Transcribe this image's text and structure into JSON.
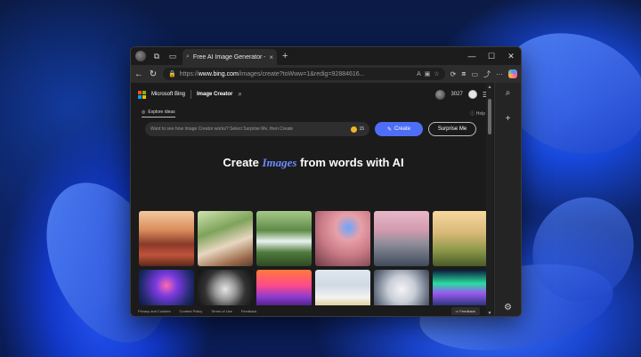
{
  "browser": {
    "tab_title": "Free AI Image Generator - Image",
    "url_prefix": "https://",
    "url_host": "www.bing.com",
    "url_path": "/images/create?toWww=1&redig=92884616..."
  },
  "bing": {
    "brand": "Microsoft Bing",
    "product": "Image Creator",
    "points": "3027"
  },
  "subnav": {
    "explore": "Explore ideas",
    "help": "Help"
  },
  "prompt": {
    "placeholder": "Want to see how Image Creator works? Select Surprise Me, then Create",
    "boosts": "15",
    "create": "Create",
    "surprise": "Surprise Me"
  },
  "hero": {
    "part1": "Create ",
    "em": "Images",
    "part2": " from words with AI"
  },
  "footer": {
    "links": [
      "Privacy and Cookies",
      "Content Policy",
      "Terms of Use",
      "Feedback"
    ],
    "feedback_btn": "Feedback"
  },
  "colors": {
    "accent": "#4f6ef7",
    "hero_em": "#6b8cff"
  }
}
